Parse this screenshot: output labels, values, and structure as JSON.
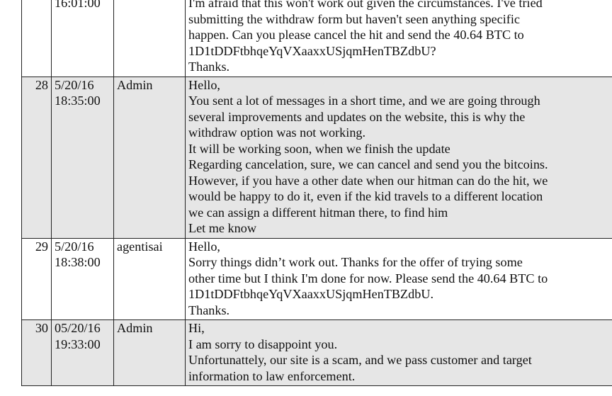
{
  "rows": [
    {
      "num": "",
      "date": [
        "16:01:00"
      ],
      "sender": "",
      "shaded": false,
      "message": [
        "I'm afraid that this won't work out given the circumstances. I've tried",
        "submitting the withdraw form but haven't seen anything specific",
        "happen. Can you please cancel the hit and send the 40.64 BTC to",
        "1D1tDDFtbhqeYqVXaaxxUSjqmHenTBZdbU?",
        "Thanks."
      ]
    },
    {
      "num": "28",
      "date": [
        "5/20/16",
        "18:35:00"
      ],
      "sender": "Admin",
      "shaded": true,
      "message": [
        "Hello,",
        "You sent a lot of messages in a short time, and we are going through",
        "several improvements and updates on the website, this is why the",
        "withdraw option was not working.",
        "It will be working soon, when we finish the update",
        "Regarding cancelation, sure, we can cancel and send you the bitcoins.",
        "However, if you have a other date when our hitman can do the hit, we",
        "would be happy to do it, even if the kid travels to a different location",
        "we can assign a different hitman there, to find him",
        "Let me know"
      ]
    },
    {
      "num": "29",
      "date": [
        "5/20/16",
        "18:38:00"
      ],
      "sender": "agentisai",
      "shaded": false,
      "message": [
        "Hello,",
        "Sorry things didn’t work out. Thanks for the offer of trying some",
        "other time but I think I'm done for now. Please send the 40.64 BTC to",
        "1D1tDDFtbhqeYqVXaaxxUSjqmHenTBZdbU.",
        "Thanks."
      ]
    },
    {
      "num": "30",
      "date": [
        "05/20/16",
        "19:33:00"
      ],
      "sender": "Admin",
      "shaded": true,
      "message": [
        "Hi,",
        "I am sorry to disappoint you.",
        "Unfortunattely, our site is a scam, and we pass customer and target",
        "information to law enforcement."
      ]
    }
  ]
}
